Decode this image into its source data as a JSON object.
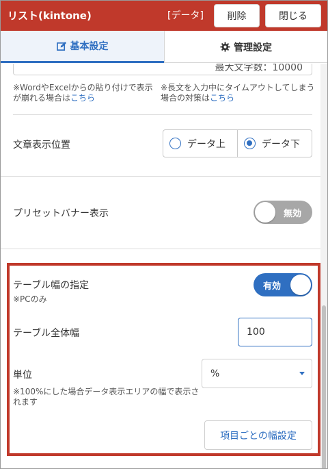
{
  "header": {
    "title": "リスト(kintone)",
    "data_tag": "[データ]",
    "delete_label": "削除",
    "close_label": "閉じる",
    "bg_color": "#c0392b"
  },
  "tabs": [
    {
      "label": "基本設定",
      "icon": "edit-icon",
      "active": true
    },
    {
      "label": "管理設定",
      "icon": "gear-icon",
      "active": false
    }
  ],
  "textarea": {
    "max_chars_text": "最大文字数：10000"
  },
  "notes": {
    "paste_prefix": "※WordやExcelからの貼り付けで表示が崩れる場合は",
    "paste_link": "こちら",
    "timeout_prefix": "※長文を入力中にタイムアウトしてしまう場合の対策は",
    "timeout_link": "こちら"
  },
  "text_position": {
    "label": "文章表示位置",
    "options": [
      "データ上",
      "データ下"
    ],
    "selected": "データ下"
  },
  "preset_banner": {
    "label": "プリセットバナー表示",
    "toggle_text": "無効",
    "enabled": false
  },
  "table_width": {
    "label": "テーブル幅の指定",
    "sub_note": "※PCのみ",
    "toggle_text": "有効",
    "enabled": true,
    "total_width_label": "テーブル全体幅",
    "total_width_value": "100",
    "unit_label": "単位",
    "unit_value": "%",
    "unit_note": "※100%にした場合データ表示エリアの幅で表示されます",
    "column_width_button": "項目ごとの幅設定"
  },
  "colors": {
    "accent": "#2f6fc1",
    "highlight_border": "#c0392b"
  }
}
